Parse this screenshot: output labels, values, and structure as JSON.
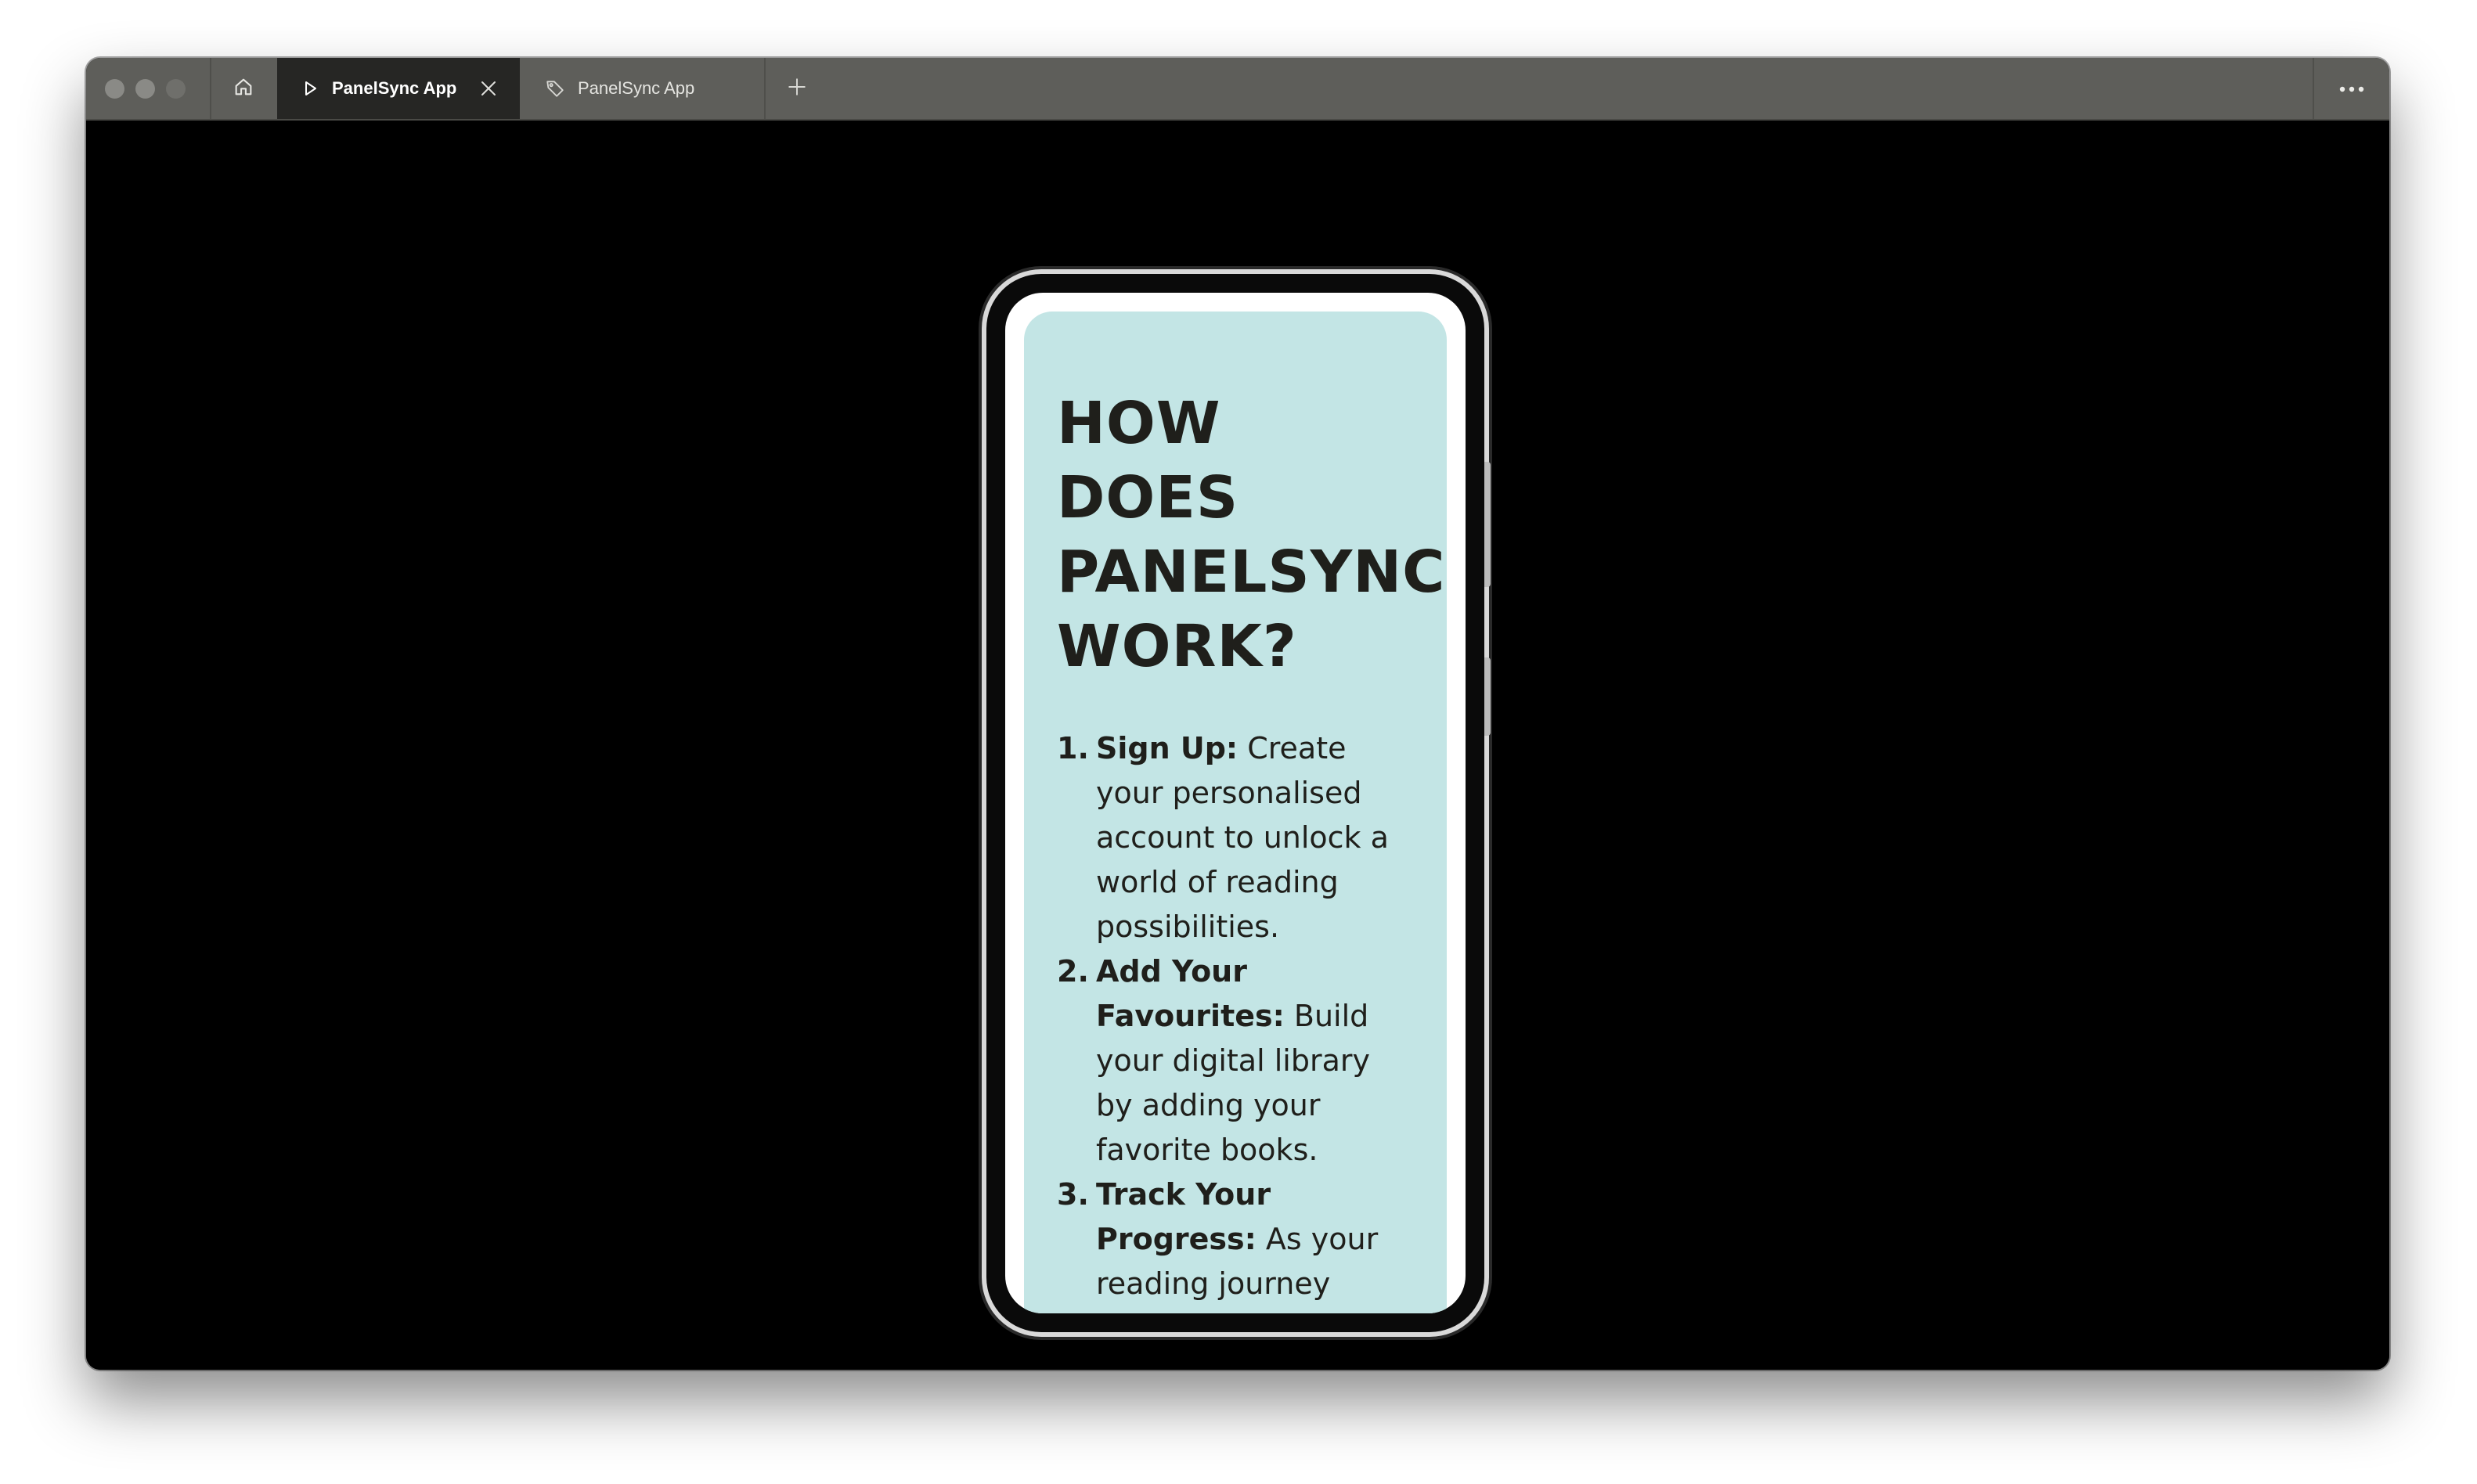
{
  "browser": {
    "tabs": [
      {
        "label": "PanelSync App",
        "icon": "play-icon",
        "active": true
      },
      {
        "label": "PanelSync App",
        "icon": "tag-icon",
        "active": false
      }
    ],
    "new_tab_label": "+",
    "more_label": "···"
  },
  "phone": {
    "heading_lines": [
      "HOW DOES",
      "PANELSYNC",
      "WORK?"
    ],
    "steps": [
      {
        "number": "1.",
        "title": "Sign Up:",
        "text": " Create your personalised account to unlock a world of reading possibilities."
      },
      {
        "number": "2.",
        "title": "Add Your Favourites:",
        "text": " Build your digital library by adding your favorite books."
      },
      {
        "number": "3.",
        "title": "Track Your Progress:",
        "text": " As your reading journey unfolds, document your progress."
      }
    ]
  },
  "colors": {
    "titlebar": "#5e5e5a",
    "active_tab": "#262624",
    "content_bg": "#000000",
    "card_bg": "#c3e5e5",
    "text": "#1f1f1b"
  }
}
